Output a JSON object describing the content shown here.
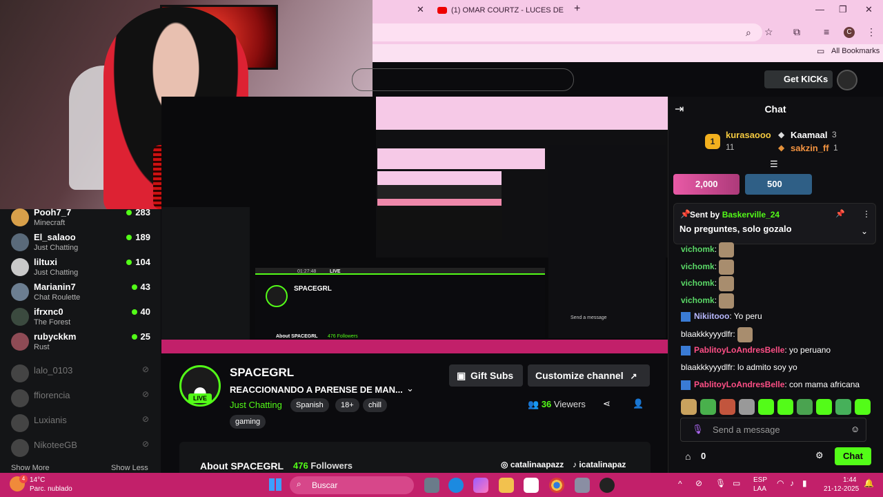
{
  "browser": {
    "tab_title": "(1) OMAR COURTZ - LUCES DE",
    "tab_close": "✕",
    "new_tab": "+",
    "bookmarks_label": "All Bookmarks",
    "profile_initial": "C"
  },
  "kick": {
    "get_kicks": "Get KICKs"
  },
  "chat": {
    "title": "Chat",
    "leaders": [
      {
        "rank": "1",
        "name": "kurasaooo",
        "sub": "11"
      },
      {
        "name": "Kaamaal",
        "sub": "3"
      },
      {
        "name": "sakzin_ff",
        "sub": "1"
      }
    ],
    "gifts": [
      "2,000",
      "500"
    ],
    "pinned": {
      "sent_by_label": "Sent by",
      "author": "Baskerville_24",
      "text": "No preguntes, solo gozalo"
    },
    "messages": [
      {
        "user": "vichomk",
        "text": ":"
      },
      {
        "user": "vichomk",
        "text": ":"
      },
      {
        "user": "vichomk",
        "text": ":"
      },
      {
        "user": "vichomk",
        "text": ":"
      },
      {
        "user": "Nikiitooo",
        "text": ": Yo peru"
      },
      {
        "user": "blaakkkyyydlfr",
        "text": ":"
      },
      {
        "user": "PablitoyLoAndresBelle",
        "text": ": yo peruano"
      },
      {
        "user": "blaakkkyyydlfr",
        "text": ": lo admito soy yo"
      },
      {
        "user": "PablitoyLoAndresBelle",
        "text": ": con mama africana"
      }
    ],
    "send_placeholder": "Send a message",
    "points": "0",
    "chat_button": "Chat"
  },
  "sidebar": {
    "channels": [
      {
        "name": "Pooh7_7",
        "category": "Minecraft",
        "viewers": "283"
      },
      {
        "name": "El_salaoo",
        "category": "Just Chatting",
        "viewers": "189"
      },
      {
        "name": "liltuxi",
        "category": "Just Chatting",
        "viewers": "104"
      },
      {
        "name": "Marianin7",
        "category": "Chat Roulette",
        "viewers": "43"
      },
      {
        "name": "ifrxnc0",
        "category": "The Forest",
        "viewers": "40"
      },
      {
        "name": "rubyckkm",
        "category": "Rust",
        "viewers": "25"
      }
    ],
    "offline": [
      "lalo_0103",
      "ffiorencia",
      "Luxianis",
      "NikoteeGB"
    ],
    "show_more": "Show More",
    "show_less": "Show Less"
  },
  "channel": {
    "name": "SPACEGRL",
    "live": "LIVE",
    "title": "REACCIONANDO A PARENSE DE MAN...",
    "category": "Just Chatting",
    "tags": [
      "Spanish",
      "18+",
      "chill",
      "gaming"
    ],
    "gift_subs": "Gift Subs",
    "customize": "Customize channel",
    "viewers_count": "36",
    "viewers_label": "Viewers",
    "about_label": "About SPACEGRL",
    "followers_count": "476",
    "followers_label": "Followers",
    "instagram": "catalinaapazz",
    "tiktok": "icatalinapaz"
  },
  "recursion": {
    "time": "01:27:48",
    "live": "LIVE",
    "name": "SPACEGRL",
    "about": "About SPACEGRL",
    "followers": "476 Followers",
    "send": "Send a message"
  },
  "taskbar": {
    "weather_temp": "14°C",
    "weather_desc": "Parc. nublado",
    "search": "Buscar",
    "lang": "ESP",
    "lang2": "LAA",
    "time": "1:44",
    "date": "21-12-2025",
    "notif": "4"
  }
}
